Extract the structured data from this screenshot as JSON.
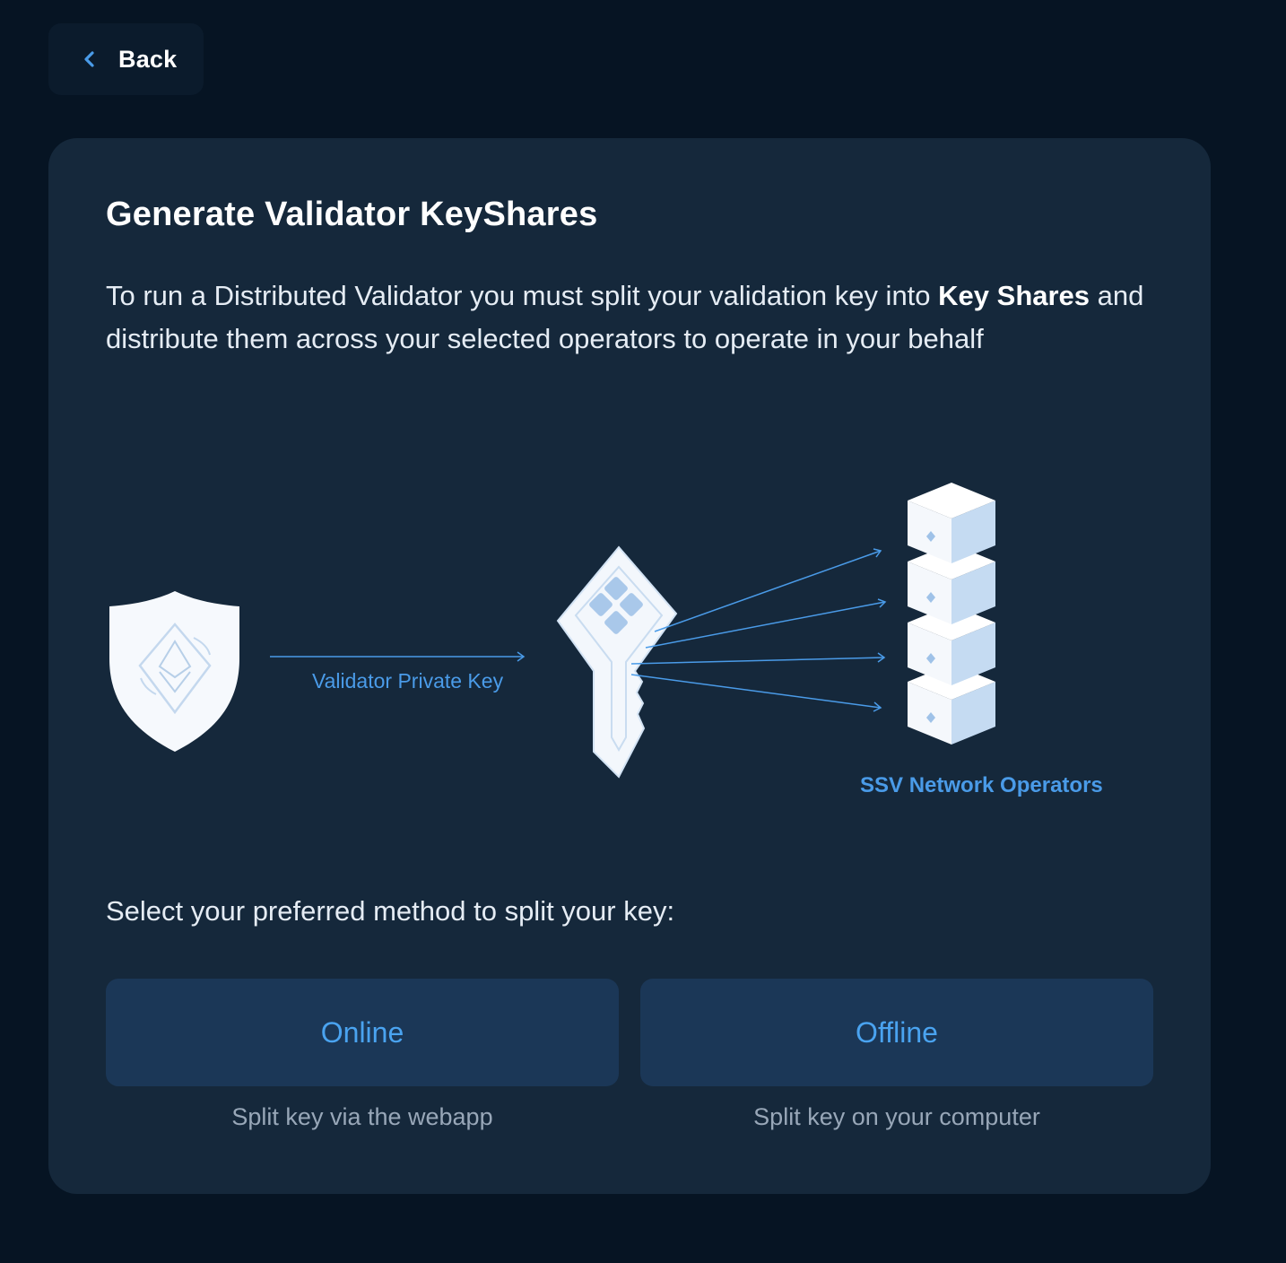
{
  "back_button": {
    "label": "Back",
    "icon": "chevron-left-icon"
  },
  "card": {
    "title": "Generate Validator KeyShares",
    "description": {
      "part1": "To run a Distributed Validator you must split your validation key into ",
      "bold": "Key Shares",
      "part2": " and distribute them across your selected operators to operate in your behalf"
    },
    "diagram": {
      "private_key_label": "Validator Private Key",
      "operators_label": "SSV Network Operators"
    },
    "select_prompt": "Select your preferred method to split your key:",
    "methods": [
      {
        "label": "Online",
        "caption": "Split key via the webapp"
      },
      {
        "label": "Offline",
        "caption": "Split key on your computer"
      }
    ]
  },
  "colors": {
    "page_bg": "#061423",
    "card_bg": "#15283b",
    "accent": "#4a9be8",
    "button_bg": "#1b3757"
  }
}
